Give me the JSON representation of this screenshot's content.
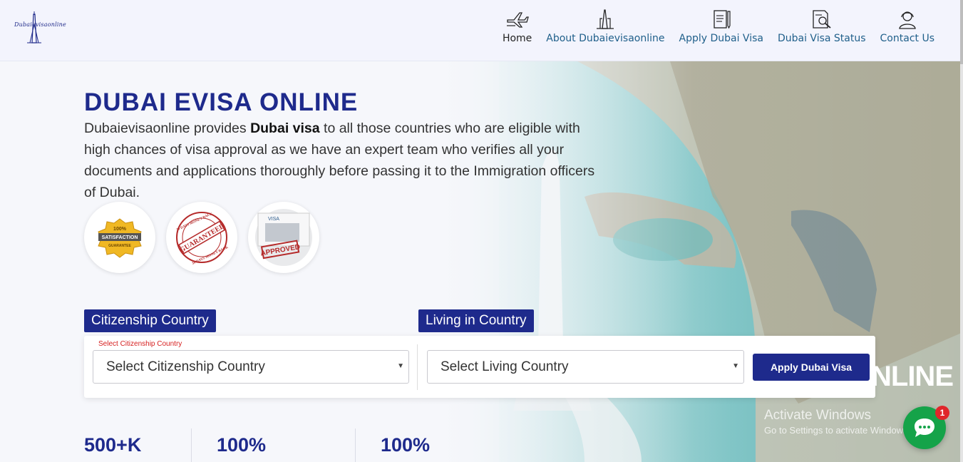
{
  "header": {
    "logo_text": "Dubaievisaonline",
    "nav": [
      {
        "label": "Home",
        "icon": "airplane-icon"
      },
      {
        "label": "About Dubaievisaonline",
        "icon": "building-icon"
      },
      {
        "label": "Apply Dubai Visa",
        "icon": "form-pen-icon"
      },
      {
        "label": "Dubai Visa Status",
        "icon": "document-search-icon"
      },
      {
        "label": "Contact Us",
        "icon": "support-agent-icon"
      }
    ]
  },
  "hero": {
    "title": "DUBAI EVISA ONLINE",
    "desc_before": "Dubaievisaonline provides ",
    "desc_bold": "Dubai visa",
    "desc_after": " to all those countries who are eligible with high chances of visa approval as we have an expert team who verifies all your documents and applications thoroughly before passing it to the Immigration officers of Dubai.",
    "badges": [
      {
        "name": "satisfaction-badge",
        "top": "100%",
        "middle": "SATISFACTION",
        "bottom": "GUARANTEE"
      },
      {
        "name": "guaranteed-stamp",
        "text": "GUARANTEED",
        "arc_top": "30 DAYS MONEY BACK",
        "arc_bottom": "30 DAYS MONEY BACK"
      },
      {
        "name": "approved-stamp",
        "text": "APPROVED",
        "tag": "VISA"
      }
    ]
  },
  "form": {
    "citizenship_label": "Citizenship Country",
    "living_label": "Living in Country",
    "citizenship_hint": "Select Citizenship Country",
    "citizenship_value": "Select Citizenship Country",
    "living_value": "Select Living Country",
    "apply_label": "Apply Dubai Visa"
  },
  "stats": [
    "500+K",
    "100%",
    "100%"
  ],
  "overlay": {
    "online_text": "NLINE",
    "activate_title": "Activate Windows",
    "activate_sub": "Go to Settings to activate Windows."
  },
  "chat": {
    "count": "1"
  },
  "colors": {
    "brand_blue": "#1e2a8c",
    "nav_link": "#1f5f8a",
    "chat_green": "#15a349",
    "badge_red": "#e0262a"
  }
}
